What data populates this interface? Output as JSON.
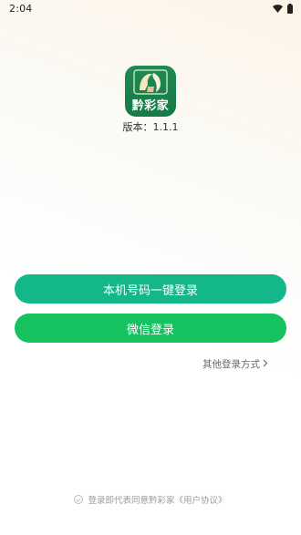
{
  "status_bar": {
    "time": "2:04",
    "icons": [
      "wifi-icon",
      "battery-icon"
    ]
  },
  "app": {
    "logo_text": "黔彩家",
    "version_label": "版本：1.1.1",
    "brand_color": "#1f8a52"
  },
  "buttons": {
    "onekey_login": "本机号码一键登录",
    "onekey_color": "#13b789",
    "wechat_login": "微信登录",
    "wechat_color": "#16c25f"
  },
  "other_login": {
    "label": "其他登录方式",
    "icon": "chevron-right-icon"
  },
  "agreement": {
    "text": "登录即代表同意黔彩家",
    "link": "《用户协议》",
    "checked": false
  }
}
